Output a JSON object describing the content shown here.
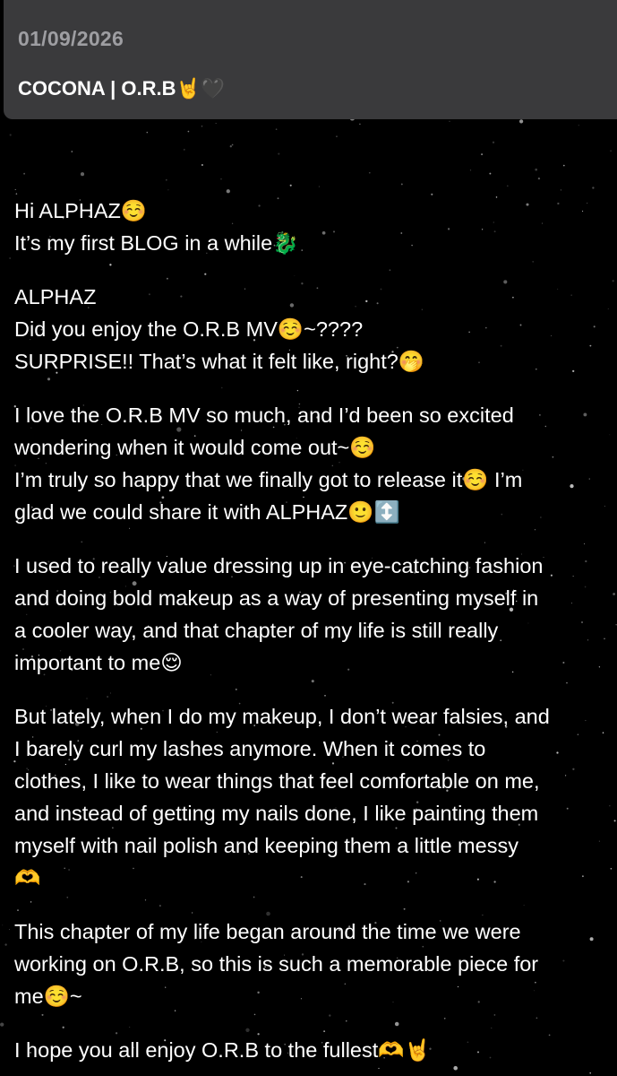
{
  "header": {
    "date": "01/09/2026",
    "title": "COCONA | O.R.B🤘🖤"
  },
  "post": {
    "greeting": {
      "line1": "Hi ALPHAZ☺️",
      "line2": "It’s my first BLOG in a while🐉"
    },
    "para2": {
      "line1": "ALPHAZ",
      "line2": "Did you enjoy the O.R.B MV☺️~????",
      "line3": "SURPRISE!! That’s what it felt like, right?🤭"
    },
    "para3": {
      "line1": "I love the O.R.B MV so much, and I’d been so excited",
      "line2": "wondering when it would come out~☺️",
      "line3": "I’m truly so happy that we finally got to release it☺️ I’m",
      "line4": "glad we could share it with ALPHAZ🙂↕️"
    },
    "para4": {
      "line1": "I used to really value dressing up in eye-catching fashion",
      "line2": "and doing bold makeup as a way of presenting myself in",
      "line3": "a cooler way, and that chapter of my life is still really",
      "line4": "important to me😌"
    },
    "para5": {
      "line1": "But lately, when I do my makeup, I don’t wear falsies, and",
      "line2": "I barely curl my lashes anymore. When it comes to",
      "line3": "clothes, I like to wear things that feel comfortable on me,",
      "line4": "and instead of getting my nails done, I like painting them",
      "line5": "myself with nail polish and keeping them a little messy",
      "line6": "🫶"
    },
    "para6": {
      "line1": "This chapter of my life began around the time we were",
      "line2": "working on O.R.B, so this is such a memorable piece for",
      "line3": "me☺️~"
    },
    "para7": {
      "line1": "I hope you all enjoy O.R.B to the fullest🫶🤘"
    }
  }
}
